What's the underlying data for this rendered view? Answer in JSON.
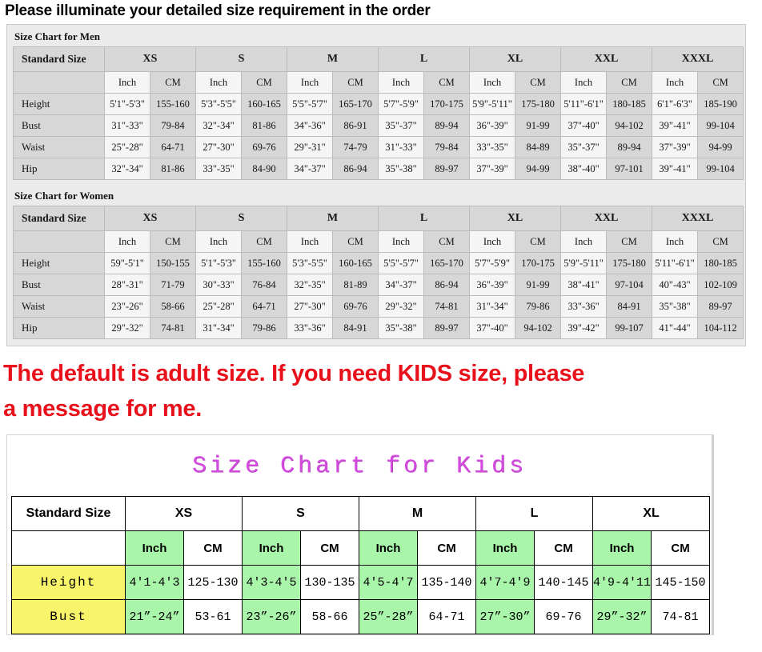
{
  "heading": "Please illuminate your detailed size requirement in the order",
  "notice": {
    "line1": "The default is adult size. If you need KIDS size, please",
    "line2": "a message for me."
  },
  "colors": {
    "notice_red": "#e8111b",
    "kids_title": "#d44be0",
    "kids_inch_green": "#a9f5a9",
    "kids_label_yellow": "#f9f56a",
    "adult_header_gray": "#d7d7d7",
    "adult_light": "#f5f5f5"
  },
  "adult": {
    "men": {
      "label": "Size Chart for Men",
      "std_size_header": "Standard Size",
      "sizes": [
        "XS",
        "S",
        "M",
        "L",
        "XL",
        "XXL",
        "XXXL"
      ],
      "units": [
        "Inch",
        "CM"
      ],
      "rows": [
        {
          "label": "Height",
          "values": [
            "5'1\"-5'3\"",
            "155-160",
            "5'3\"-5'5\"",
            "160-165",
            "5'5\"-5'7\"",
            "165-170",
            "5'7\"-5'9\"",
            "170-175",
            "5'9\"-5'11\"",
            "175-180",
            "5'11\"-6'1\"",
            "180-185",
            "6'1\"-6'3\"",
            "185-190"
          ]
        },
        {
          "label": "Bust",
          "values": [
            "31\"-33\"",
            "79-84",
            "32\"-34\"",
            "81-86",
            "34\"-36\"",
            "86-91",
            "35\"-37\"",
            "89-94",
            "36\"-39\"",
            "91-99",
            "37\"-40\"",
            "94-102",
            "39\"-41\"",
            "99-104"
          ]
        },
        {
          "label": "Waist",
          "values": [
            "25\"-28\"",
            "64-71",
            "27\"-30\"",
            "69-76",
            "29\"-31\"",
            "74-79",
            "31\"-33\"",
            "79-84",
            "33\"-35\"",
            "84-89",
            "35\"-37\"",
            "89-94",
            "37\"-39\"",
            "94-99"
          ]
        },
        {
          "label": "Hip",
          "values": [
            "32\"-34\"",
            "81-86",
            "33\"-35\"",
            "84-90",
            "34\"-37\"",
            "86-94",
            "35\"-38\"",
            "89-97",
            "37\"-39\"",
            "94-99",
            "38\"-40\"",
            "97-101",
            "39\"-41\"",
            "99-104"
          ]
        }
      ]
    },
    "women": {
      "label": "Size Chart for Women",
      "std_size_header": "Standard Size",
      "sizes": [
        "XS",
        "S",
        "M",
        "L",
        "XL",
        "XXL",
        "XXXL"
      ],
      "units": [
        "Inch",
        "CM"
      ],
      "rows": [
        {
          "label": "Height",
          "values": [
            "59\"-5'1\"",
            "150-155",
            "5'1\"-5'3\"",
            "155-160",
            "5'3\"-5'5\"",
            "160-165",
            "5'5\"-5'7\"",
            "165-170",
            "5'7\"-5'9\"",
            "170-175",
            "5'9\"-5'11\"",
            "175-180",
            "5'11\"-6'1\"",
            "180-185"
          ]
        },
        {
          "label": "Bust",
          "values": [
            "28\"-31\"",
            "71-79",
            "30\"-33\"",
            "76-84",
            "32\"-35\"",
            "81-89",
            "34\"-37\"",
            "86-94",
            "36\"-39\"",
            "91-99",
            "38\"-41\"",
            "97-104",
            "40\"-43\"",
            "102-109"
          ]
        },
        {
          "label": "Waist",
          "values": [
            "23\"-26\"",
            "58-66",
            "25\"-28\"",
            "64-71",
            "27\"-30\"",
            "69-76",
            "29\"-32\"",
            "74-81",
            "31\"-34\"",
            "79-86",
            "33\"-36\"",
            "84-91",
            "35\"-38\"",
            "89-97"
          ]
        },
        {
          "label": "Hip",
          "values": [
            "29\"-32\"",
            "74-81",
            "31\"-34\"",
            "79-86",
            "33\"-36\"",
            "84-91",
            "35\"-38\"",
            "89-97",
            "37\"-40\"",
            "94-102",
            "39\"-42\"",
            "99-107",
            "41\"-44\"",
            "104-112"
          ]
        }
      ]
    }
  },
  "kids": {
    "title": "Size Chart for Kids",
    "std_size_header": "Standard Size",
    "sizes": [
      "XS",
      "S",
      "M",
      "L",
      "XL"
    ],
    "units": [
      "Inch",
      "CM"
    ],
    "rows": [
      {
        "label": "Height",
        "values": [
          "4'1-4'3",
          "125-130",
          "4'3-4'5",
          "130-135",
          "4'5-4'7",
          "135-140",
          "4'7-4'9",
          "140-145",
          "4'9-4'11",
          "145-150"
        ]
      },
      {
        "label": "Bust",
        "values": [
          "21”-24”",
          "53-61",
          "23”-26”",
          "58-66",
          "25”-28”",
          "64-71",
          "27”-30”",
          "69-76",
          "29”-32”",
          "74-81"
        ]
      }
    ]
  }
}
